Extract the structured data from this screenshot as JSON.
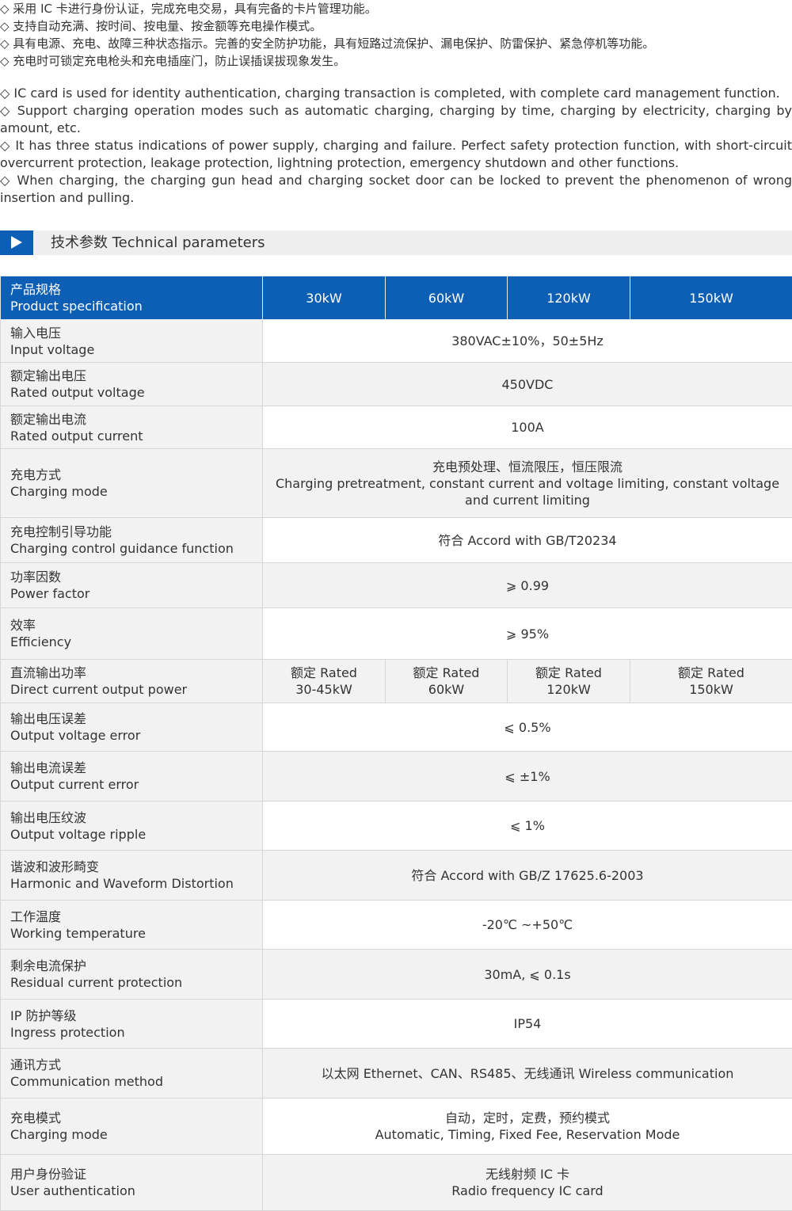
{
  "features": {
    "zh": [
      "◇ 采用 IC 卡进行身份认证，完成充电交易，具有完备的卡片管理功能。",
      "◇ 支持自动充满、按时间、按电量、按金额等充电操作模式。",
      "◇ 具有电源、充电、故障三种状态指示。完善的安全防护功能，具有短路过流保护、漏电保护、防雷保护、紧急停机等功能。",
      "◇ 充电时可锁定充电枪头和充电插座门，防止误插误拔现象发生。"
    ],
    "en": [
      "◇ IC card is used for identity authentication, charging transaction is completed, with complete card management function.",
      "◇ Support charging operation modes such as automatic charging, charging by time, charging by electricity, charging by amount, etc.",
      "◇ It has three status indications of power supply, charging and failure. Perfect safety protection function, with short-circuit overcurrent protection, leakage protection, lightning protection, emergency shutdown and other functions.",
      "◇ When charging, the charging gun head and charging socket door can be locked to prevent the phenomenon of wrong insertion and pulling."
    ]
  },
  "section": {
    "title": "技术参数 Technical parameters",
    "icon": "play-triangle-icon"
  },
  "table": {
    "header": {
      "label_zh": "产品规格",
      "label_en": "Product specification",
      "columns": [
        "30kW",
        "60kW",
        "120kW",
        "150kW"
      ]
    },
    "rows": [
      {
        "zh": "输入电压",
        "en": "Input voltage",
        "value": [
          "380VAC±10%，50±5Hz"
        ]
      },
      {
        "zh": "额定输出电压",
        "en": "Rated output voltage",
        "value": [
          "450VDC"
        ]
      },
      {
        "zh": "额定输出电流",
        "en": "Rated output current",
        "value": [
          "100A"
        ]
      },
      {
        "zh": "充电方式",
        "en": "Charging mode",
        "value": [
          "充电预处理、恒流限压，恒压限流",
          "Charging pretreatment, constant current and voltage limiting, constant voltage",
          "and current limiting"
        ]
      },
      {
        "zh": "充电控制引导功能",
        "en": "Charging control guidance function",
        "value": [
          "符合 Accord with GB/T20234"
        ]
      },
      {
        "zh": "功率因数",
        "en": "Power factor",
        "value": [
          "⩾ 0.99"
        ]
      },
      {
        "zh": "效率",
        "en": "Efficiency",
        "value": [
          "⩾ 95%"
        ]
      },
      {
        "zh": "直流输出功率",
        "en": "Direct current output power",
        "split": [
          [
            "额定 Rated",
            "30-45kW"
          ],
          [
            "额定 Rated",
            "60kW"
          ],
          [
            "额定 Rated",
            "120kW"
          ],
          [
            "额定 Rated",
            "150kW"
          ]
        ]
      },
      {
        "zh": "输出电压误差",
        "en": "Output voltage error",
        "value": [
          "⩽ 0.5%"
        ]
      },
      {
        "zh": "输出电流误差",
        "en": "Output current error",
        "value": [
          "⩽ ±1%"
        ]
      },
      {
        "zh": "输出电压纹波",
        "en": "Output voltage ripple",
        "value": [
          "⩽ 1%"
        ]
      },
      {
        "zh": "谐波和波形畸变",
        "en": "Harmonic and Waveform Distortion",
        "value": [
          "符合 Accord with GB/Z 17625.6-2003"
        ]
      },
      {
        "zh": "工作温度",
        "en": "Working temperature",
        "value": [
          "-20℃ ~+50℃"
        ]
      },
      {
        "zh": "剩余电流保护",
        "en": "Residual current protection",
        "value": [
          "30mA, ⩽ 0.1s"
        ]
      },
      {
        "zh": "IP 防护等级",
        "en": "Ingress protection",
        "value": [
          "IP54"
        ]
      },
      {
        "zh": "通讯方式",
        "en": "Communication method",
        "value": [
          "以太网 Ethernet、CAN、RS485、无线通讯 Wireless communication"
        ]
      },
      {
        "zh": "充电模式",
        "en": "Charging mode",
        "value": [
          "自动，定时，定费，预约模式",
          "Automatic, Timing, Fixed Fee, Reservation Mode"
        ]
      },
      {
        "zh": "用户身份验证",
        "en": "User authentication",
        "value": [
          "无线射频 IC 卡",
          "Radio frequency IC card"
        ]
      }
    ]
  },
  "colors": {
    "accent": "#0d5fb5",
    "row_alt": "#f2f2f2",
    "border": "#d6d6d6",
    "text": "#333333"
  }
}
